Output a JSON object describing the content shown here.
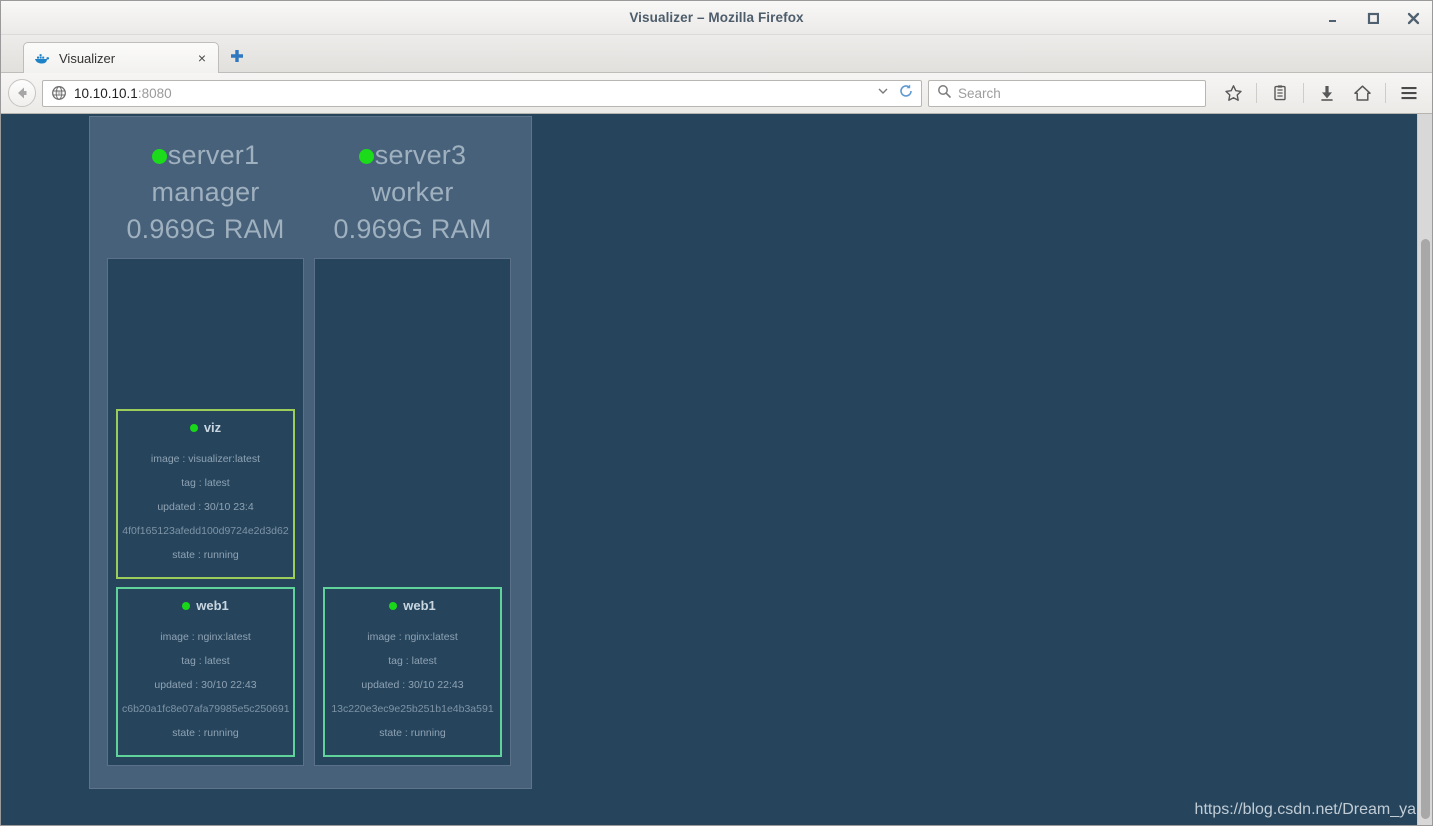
{
  "window": {
    "title": "Visualizer – Mozilla Firefox",
    "controls": {
      "minimize": "minimize-button",
      "maximize": "maximize-button",
      "close": "close-button"
    }
  },
  "tabs": {
    "items": [
      {
        "label": "Visualizer",
        "favicon": "docker-whale-icon",
        "close": "×"
      }
    ],
    "new_tab_label": "+"
  },
  "navbar": {
    "back_icon": "back-arrow-icon",
    "site_icon": "globe-icon",
    "url_host": "10.10.10.1",
    "url_port": ":8080",
    "url_full": "10.10.10.1:8080",
    "dropdown_icon": "chevron-down-icon",
    "reload_icon": "reload-icon",
    "search": {
      "icon": "search-icon",
      "placeholder": "Search",
      "value": ""
    },
    "buttons": [
      {
        "name": "bookmark-star-icon",
        "label": "star"
      },
      {
        "name": "library-icon",
        "label": "library"
      },
      {
        "name": "downloads-icon",
        "label": "downloads"
      },
      {
        "name": "home-icon",
        "label": "home"
      },
      {
        "name": "menu-icon",
        "label": "menu"
      }
    ]
  },
  "page": {
    "background_color": "#26455d",
    "panel_color": "#47617a",
    "watermark": "https://blog.csdn.net/Dream_ya"
  },
  "swarm": {
    "nodes": [
      {
        "name": "server1",
        "role": "manager",
        "memory": "0.969G RAM",
        "status": "green",
        "containers": [
          {
            "name": "viz",
            "status": "green",
            "border_color": "#9ccc5a",
            "image": "image : visualizer:latest",
            "tag": "tag : latest",
            "updated": "updated : 30/10 23:4",
            "hash": "4f0f165123afedd100d9724e2d3d62",
            "state": "state : running"
          },
          {
            "name": "web1",
            "status": "green",
            "border_color": "#5fd39a",
            "image": "image : nginx:latest",
            "tag": "tag : latest",
            "updated": "updated : 30/10 22:43",
            "hash": "c6b20a1fc8e07afa79985e5c250691",
            "state": "state : running"
          }
        ]
      },
      {
        "name": "server3",
        "role": "worker",
        "memory": "0.969G RAM",
        "status": "green",
        "containers": [
          {
            "name": "web1",
            "status": "green",
            "border_color": "#5fd39a",
            "image": "image : nginx:latest",
            "tag": "tag : latest",
            "updated": "updated : 30/10 22:43",
            "hash": "13c220e3ec9e25b251b1e4b3a591",
            "state": "state : running"
          }
        ]
      }
    ]
  }
}
